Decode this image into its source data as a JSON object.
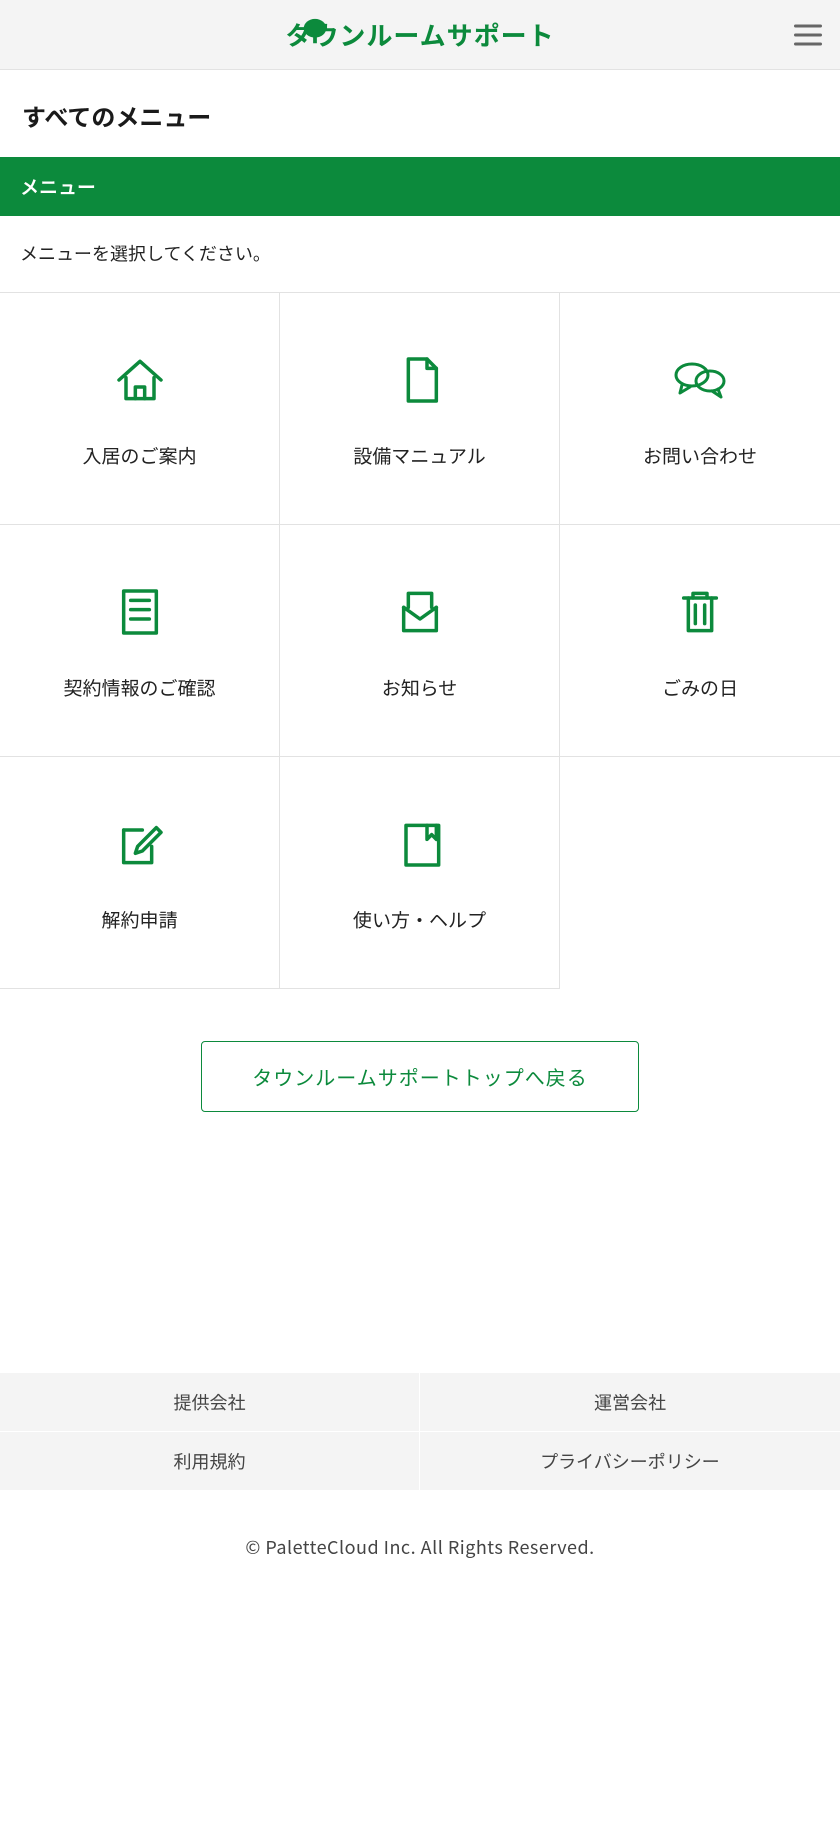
{
  "colors": {
    "primary": "#0c8a3c"
  },
  "header": {
    "brand_name": "タウンルームサポート",
    "brand_icon": "tree-icon",
    "menu_button": "hamburger-icon"
  },
  "page": {
    "title": "すべてのメニュー",
    "section_label": "メニュー",
    "instruction": "メニューを選択してください。"
  },
  "menu": {
    "items": [
      {
        "key": "guide",
        "icon": "house-icon",
        "label": "入居のご案内"
      },
      {
        "key": "manual",
        "icon": "document-icon",
        "label": "設備マニュアル"
      },
      {
        "key": "contact",
        "icon": "chat-icon",
        "label": "お問い合わせ"
      },
      {
        "key": "contract",
        "icon": "list-icon",
        "label": "契約情報のご確認"
      },
      {
        "key": "news",
        "icon": "mail-icon",
        "label": "お知らせ"
      },
      {
        "key": "garbage",
        "icon": "trash-icon",
        "label": "ごみの日"
      },
      {
        "key": "cancel",
        "icon": "edit-icon",
        "label": "解約申請"
      },
      {
        "key": "help",
        "icon": "book-icon",
        "label": "使い方・ヘルプ"
      }
    ]
  },
  "back_button": {
    "label": "タウンルームサポートトップへ戻る"
  },
  "footer": {
    "links": [
      {
        "label": "提供会社"
      },
      {
        "label": "運営会社"
      },
      {
        "label": "利用規約"
      },
      {
        "label": "プライバシーポリシー"
      }
    ],
    "copyright": "© PaletteCloud Inc. All Rights Reserved."
  }
}
